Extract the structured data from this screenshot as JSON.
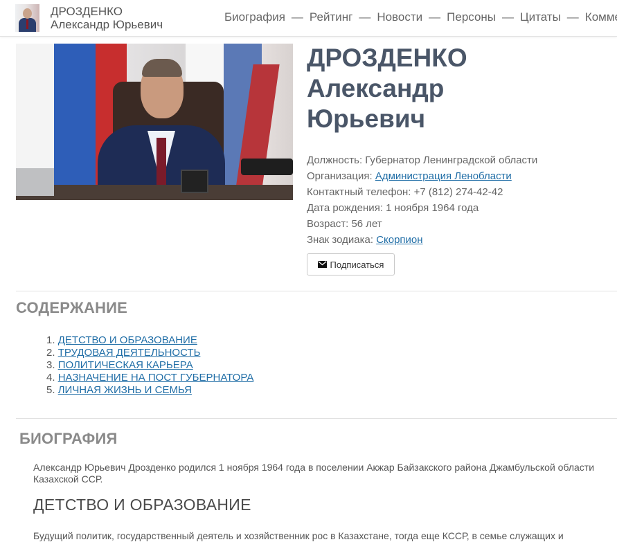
{
  "header": {
    "brand_line1": "ДРОЗДЕНКО",
    "brand_line2": "Александр Юрьевич",
    "nav": [
      "Биография",
      "Рейтинг",
      "Новости",
      "Персоны",
      "Цитаты",
      "Комме"
    ],
    "separator": "—"
  },
  "profile": {
    "name_line1": "ДРОЗДЕНКО",
    "name_line2": "Александр",
    "name_line3": "Юрьевич",
    "position_label": "Должность:",
    "position_value": "Губернатор Ленинградской области",
    "organization_label": "Организация:",
    "organization_link": "Администрация Ленобласти",
    "phone_label": "Контактный телефон:",
    "phone_value": "+7 (812) 274-42-42",
    "birth_label": "Дата рождения:",
    "birth_value": "1 ноября 1964 года",
    "age_label": "Возраст:",
    "age_value": "56 лет",
    "zodiac_label": "Знак зодиака:",
    "zodiac_link": "Скорпион",
    "subscribe_label": "Подписаться"
  },
  "toc": {
    "title": "СОДЕРЖАНИЕ",
    "items": [
      {
        "num": "1.",
        "label": "ДЕТСТВО И ОБРАЗОВАНИЕ"
      },
      {
        "num": "2.",
        "label": "ТРУДОВАЯ ДЕЯТЕЛЬНОСТЬ"
      },
      {
        "num": "3.",
        "label": "ПОЛИТИЧЕСКАЯ КАРЬЕРА"
      },
      {
        "num": "4.",
        "label": "НАЗНАЧЕНИЕ НА ПОСТ ГУБЕРНАТОРА"
      },
      {
        "num": "5.",
        "label": "ЛИЧНАЯ ЖИЗНЬ И СЕМЬЯ"
      }
    ]
  },
  "biography": {
    "title": "БИОГРАФИЯ",
    "intro": "Александр Юрьевич Дрозденко родился 1 ноября 1964 года в поселении Акжар Байзакского района Джамбульской области Казахской ССР.",
    "subheading": "ДЕТСТВО И ОБРАЗОВАНИЕ",
    "cut_line": "Будущий политик, государственный деятель и хозяйственник рос в Казахстане, тогда еще КССР, в семье служащих и"
  },
  "colors": {
    "link": "#1f6da6",
    "name_heading": "#4a5668",
    "section_heading": "#8a8a8a"
  }
}
